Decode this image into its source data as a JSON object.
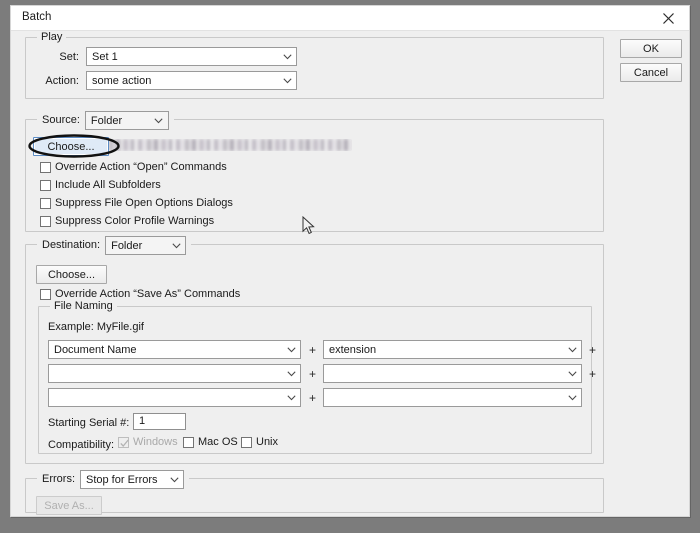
{
  "window": {
    "title": "Batch",
    "close_icon": "close-icon"
  },
  "buttons": {
    "ok": "OK",
    "cancel": "Cancel"
  },
  "play": {
    "legend": "Play",
    "set_label": "Set:",
    "set_value": "Set 1",
    "action_label": "Action:",
    "action_value": "some action"
  },
  "source": {
    "legend_label": "Source:",
    "value": "Folder",
    "choose_button": "Choose...",
    "path_value": "",
    "checkboxes": [
      {
        "label": "Override Action “Open” Commands",
        "checked": false,
        "disabled": false
      },
      {
        "label": "Include All Subfolders",
        "checked": false,
        "disabled": false
      },
      {
        "label": "Suppress File Open Options Dialogs",
        "checked": false,
        "disabled": false
      },
      {
        "label": "Suppress Color Profile Warnings",
        "checked": false,
        "disabled": false
      }
    ]
  },
  "destination": {
    "legend_label": "Destination:",
    "value": "Folder",
    "choose_button": "Choose...",
    "override_checkbox": {
      "label": "Override Action “Save As” Commands",
      "checked": false
    },
    "file_naming": {
      "legend": "File Naming",
      "example_label": "Example: MyFile.gif",
      "plus_symbol": "+",
      "rows": [
        {
          "left_value": "Document Name",
          "right_value": "extension",
          "has_trailing_plus": true
        },
        {
          "left_value": "",
          "right_value": "",
          "has_trailing_plus": true
        },
        {
          "left_value": "",
          "right_value": "",
          "has_trailing_plus": false
        }
      ],
      "serial_label": "Starting Serial #:",
      "serial_value": "1",
      "compatibility_label": "Compatibility:",
      "compatibility": [
        {
          "label": "Windows",
          "checked": true,
          "disabled": true
        },
        {
          "label": "Mac OS",
          "checked": false,
          "disabled": false
        },
        {
          "label": "Unix",
          "checked": false,
          "disabled": false
        }
      ]
    }
  },
  "errors": {
    "legend_label": "Errors:",
    "value": "Stop for Errors",
    "save_as_button": "Save As...",
    "save_as_disabled": true
  },
  "colors": {
    "desktop": "#7c7c7c",
    "dialog_bg": "#efefef",
    "titlebar_bg": "#ffffff",
    "focus_blue": "#dfeaf7",
    "annotation": "#111111",
    "disabled_text": "#b0b0b0"
  }
}
